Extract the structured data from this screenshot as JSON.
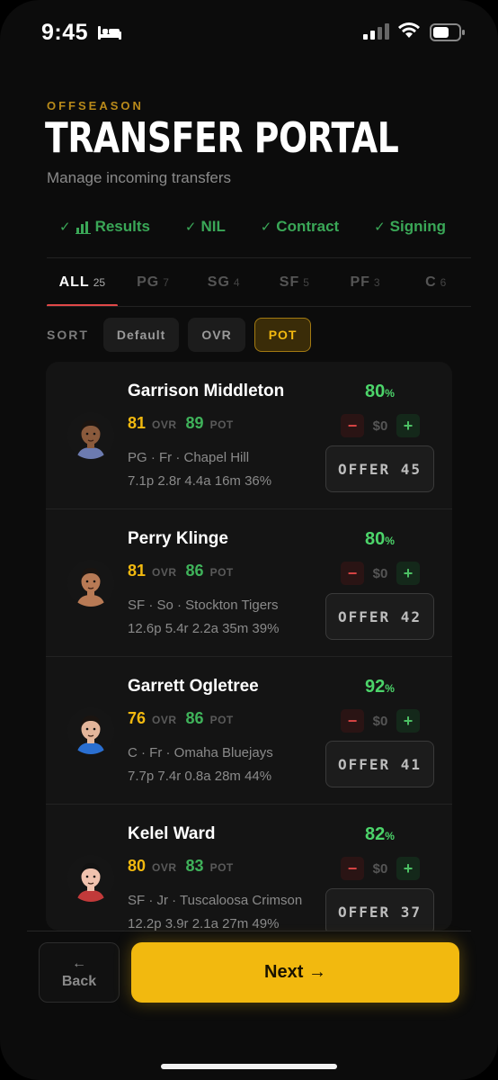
{
  "status_bar": {
    "time": "9:45"
  },
  "header": {
    "eyebrow": "OFFSEASON",
    "title": "TRANSFER PORTAL",
    "subtitle": "Manage incoming transfers"
  },
  "steps": [
    {
      "label": "Results"
    },
    {
      "label": "NIL"
    },
    {
      "label": "Contract"
    },
    {
      "label": "Signing"
    }
  ],
  "tabs": [
    {
      "label": "ALL",
      "count": "25",
      "active": true
    },
    {
      "label": "PG",
      "count": "7"
    },
    {
      "label": "SG",
      "count": "4"
    },
    {
      "label": "SF",
      "count": "5"
    },
    {
      "label": "PF",
      "count": "3"
    },
    {
      "label": "C",
      "count": "6"
    }
  ],
  "sort": {
    "label": "SORT",
    "options": [
      "Default",
      "OVR",
      "POT"
    ],
    "selected": "POT"
  },
  "labels": {
    "ovr": "OVR",
    "pot": "POT",
    "pct_unit": "%"
  },
  "players": [
    {
      "name": "Garrison Middleton",
      "ovr": "81",
      "pot": "89",
      "meta": "PG · Fr · Chapel Hill",
      "stats": "7.1p 2.8r 4.4a 16m 36%",
      "interest": "80",
      "nil": "$0",
      "offer": "OFFER 45",
      "skin": "#8a5a3c",
      "hair": "#1b1410",
      "shirt": "#6c7bb0"
    },
    {
      "name": "Perry Klinge",
      "ovr": "81",
      "pot": "86",
      "meta": "SF · So · Stockton Tigers",
      "stats": "12.6p 5.4r 2.2a 35m 39%",
      "interest": "80",
      "nil": "$0",
      "offer": "OFFER 42",
      "skin": "#b87a55",
      "hair": "#1b1410",
      "shirt": "#b87a55"
    },
    {
      "name": "Garrett Ogletree",
      "ovr": "76",
      "pot": "86",
      "meta": "C · Fr · Omaha Bluejays",
      "stats": "7.7p 7.4r 0.8a 28m 44%",
      "interest": "92",
      "nil": "$0",
      "offer": "OFFER 41",
      "skin": "#e3b59a",
      "hair": "#1b1410",
      "shirt": "#2a6fd1"
    },
    {
      "name": "Kelel Ward",
      "ovr": "80",
      "pot": "83",
      "meta": "SF · Jr · Tuscaloosa Crimson",
      "stats": "12.2p 3.9r 2.1a 27m 49%",
      "interest": "82",
      "nil": "$0",
      "offer": "OFFER 37",
      "skin": "#f0c2ae",
      "hair": "#121212",
      "shirt": "#c23a3a"
    }
  ],
  "footer": {
    "back_arrow": "←",
    "back": "Back",
    "next": "Next →"
  }
}
